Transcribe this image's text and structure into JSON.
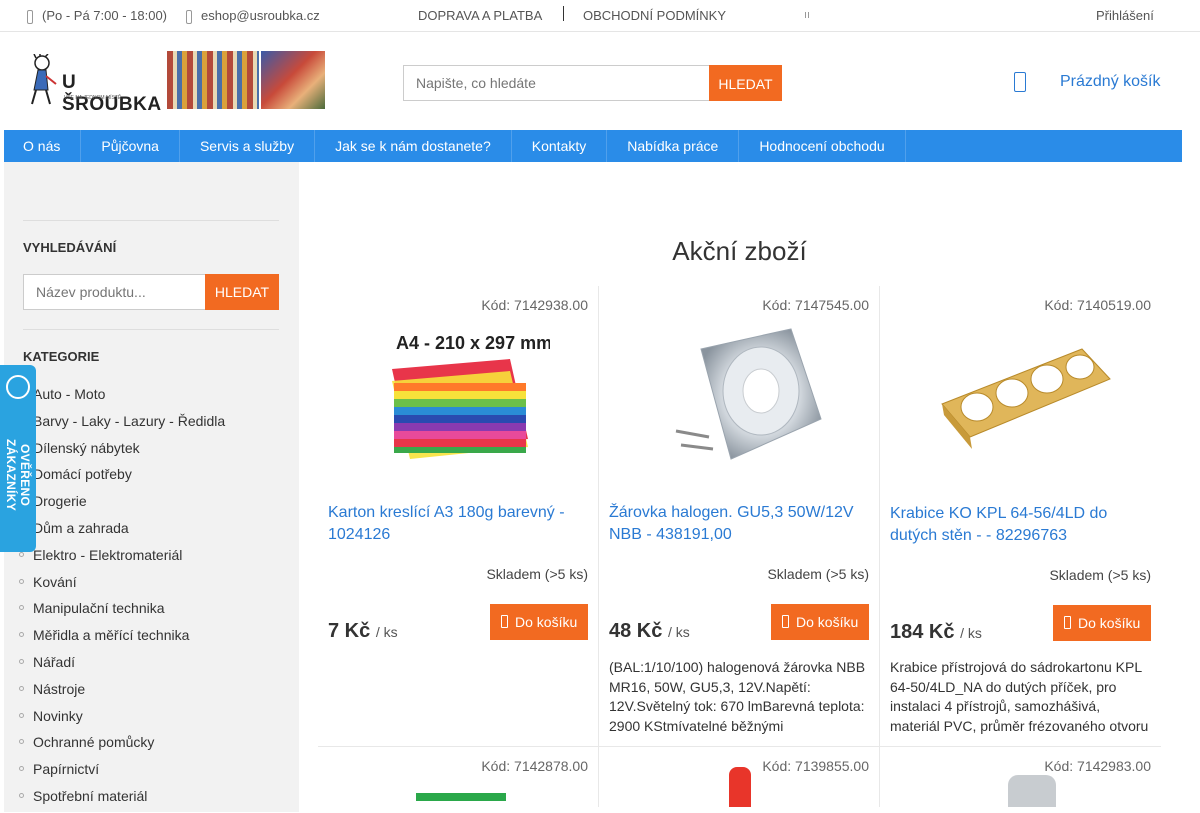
{
  "topbar": {
    "hours": "(Po - Pá 7:00 - 18:00)",
    "email": "eshop@usroubka.cz",
    "shipping_link": "DOPRAVA A PLATBA",
    "terms_link": "OBCHODNÍ PODMÍNKY",
    "login": "Přihlášení"
  },
  "header": {
    "logo_text": "U ŠROUBKA",
    "logo_sub": "VŠE NA JEDNOM MÍSTĚ",
    "search_placeholder": "Napište, co hledáte",
    "search_button": "HLEDAT",
    "cart_label": "Prázdný košík"
  },
  "nav": {
    "items": [
      "O nás",
      "Půjčovna",
      "Servis a služby",
      "Jak se k nám dostanete?",
      "Kontakty",
      "Nabídka práce",
      "Hodnocení obchodu"
    ]
  },
  "sidebar": {
    "search_heading": "VYHLEDÁVÁNÍ",
    "search_placeholder": "Název produktu...",
    "search_button": "HLEDAT",
    "categories_heading": "KATEGORIE",
    "categories": [
      "Auto - Moto",
      "Barvy - Laky - Lazury - Ředidla",
      "Dílenský nábytek",
      "Domácí potřeby",
      "Drogerie",
      "Dům a zahrada",
      "Elektro - Elektromateriál",
      "Kování",
      "Manipulační technika",
      "Měřidla a měřící technika",
      "Nářadí",
      "Nástroje",
      "Novinky",
      "Ochranné pomůcky",
      "Papírnictví",
      "Spotřební materiál"
    ],
    "badge_text": "OVĚŘENO ZÁKAZNÍKY"
  },
  "main": {
    "title": "Akční zboží",
    "products": [
      {
        "code": "Kód: 7142938.00",
        "name": "Karton kreslící A3 180g barevný - 1024126",
        "stock": "Skladem (>5 ks)",
        "price": "7 Kč",
        "unit": "/ ks",
        "button": "Do košíku",
        "desc": "",
        "image_label": "A4 - 210 x 297 mm"
      },
      {
        "code": "Kód: 7147545.00",
        "name": "Žárovka halogen. GU5,3 50W/12V NBB - 438191,00",
        "stock": "Skladem (>5 ks)",
        "price": "48 Kč",
        "unit": "/ ks",
        "button": "Do košíku",
        "desc": "(BAL:1/10/100) halogenová žárovka NBB MR16, 50W, GU5,3, 12V.Napětí: 12V.Světelný tok: 670 lmBarevná teplota: 2900 KStmívatelné běžnými"
      },
      {
        "code": "Kód: 7140519.00",
        "name": "Krabice KO KPL 64-56/4LD do dutých stěn - - 82296763",
        "stock": "Skladem (>5 ks)",
        "price": "184 Kč",
        "unit": "/ ks",
        "button": "Do košíku",
        "desc": "Krabice přístrojová do sádrokartonu KPL 64-50/4LD_NA do dutých příček, pro instalaci 4 přístrojů, samozhášivá, materiál PVC, průměr frézovaného otvoru"
      }
    ],
    "row2_codes": [
      "Kód: 7142878.00",
      "Kód: 7139855.00",
      "Kód: 7142983.00"
    ]
  },
  "colors": {
    "accent_orange": "#f26a21",
    "nav_blue": "#2a8ce8",
    "link_blue": "#2a7ad3",
    "badge_blue": "#2aa3e0"
  }
}
